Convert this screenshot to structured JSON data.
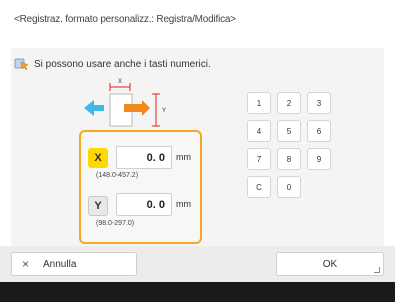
{
  "header": {
    "title": "<Registraz. formato personalizz.: Registra/Modifica>"
  },
  "hint": {
    "text": "Si possono usare anche i tasti numerici."
  },
  "diagram": {
    "x_label": "X",
    "y_label": "Y"
  },
  "dimensions": {
    "x": {
      "label": "X",
      "value": "0. 0",
      "unit": "mm",
      "range": "(148.0-457.2)",
      "selected": true
    },
    "y": {
      "label": "Y",
      "value": "0. 0",
      "unit": "mm",
      "range": "(98.0-297.0)",
      "selected": false
    }
  },
  "keypad": {
    "keys": [
      "1",
      "2",
      "3",
      "4",
      "5",
      "6",
      "7",
      "8",
      "9",
      "C",
      "0"
    ]
  },
  "footer": {
    "cancel_label": "Annulla",
    "cancel_icon": "×",
    "ok_label": "OK"
  },
  "colors": {
    "accent_border": "#f5a623",
    "selected_axis": "#ffd800",
    "footer_bar": "#1a1a1a"
  }
}
